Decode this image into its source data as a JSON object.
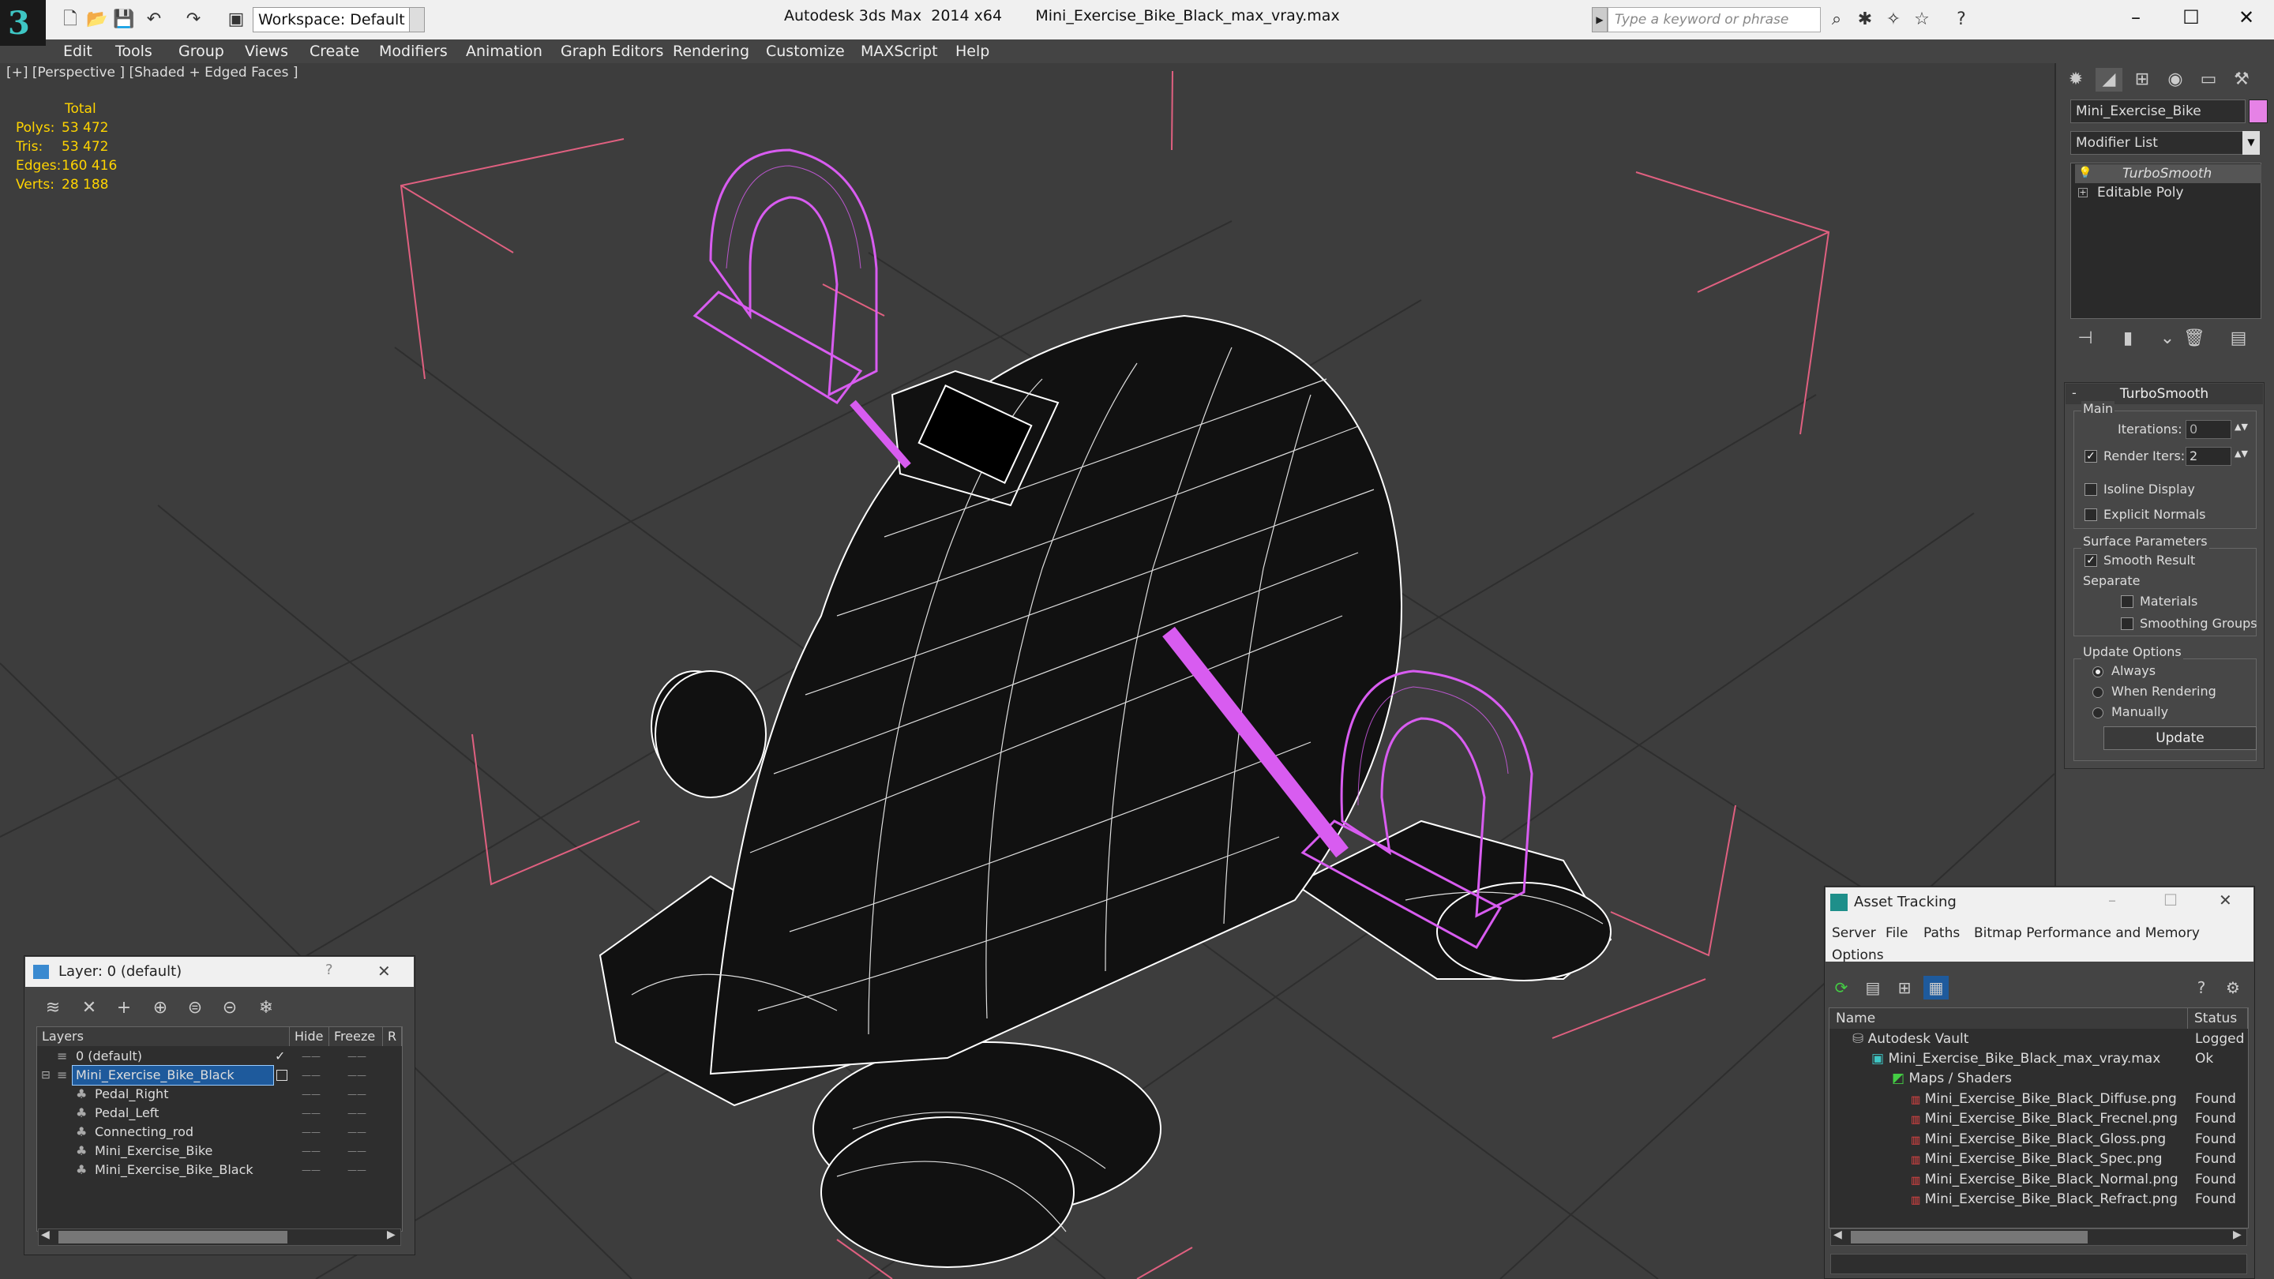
{
  "titlebar": {
    "app_title": "Autodesk 3ds Max  2014 x64       Mini_Exercise_Bike_Black_max_vray.max",
    "workspace": "Workspace: Default",
    "search_placeholder": "Type a keyword or phrase",
    "minimize": "–",
    "maximize": "☐",
    "close": "✕"
  },
  "menu": [
    "Edit",
    "Tools",
    "Group",
    "Views",
    "Create",
    "Modifiers",
    "Animation",
    "Graph Editors",
    "Rendering",
    "Customize",
    "MAXScript",
    "Help"
  ],
  "viewport": {
    "label": "[+] [Perspective ] [Shaded + Edged Faces ]",
    "stats": {
      "header": "Total",
      "polys_label": "Polys:",
      "polys": "53 472",
      "tris_label": "Tris:",
      "tris": "53 472",
      "edges_label": "Edges:",
      "edges": "160 416",
      "verts_label": "Verts:",
      "verts": "28 188"
    }
  },
  "command_panel": {
    "object_name": "Mini_Exercise_Bike",
    "object_color": "#e682e6",
    "modifier_list": "Modifier List",
    "stack": [
      "TurboSmooth",
      "Editable Poly"
    ],
    "turbosmooth": {
      "title": "TurboSmooth",
      "main_label": "Main",
      "iterations_label": "Iterations:",
      "iterations": "0",
      "render_iters_label": "Render Iters:",
      "render_iters": "2",
      "render_iters_checked": true,
      "isoline_display": "Isoline Display",
      "explicit_normals": "Explicit Normals",
      "surface_parameters": "Surface Parameters",
      "smooth_result": "Smooth Result",
      "separate": "Separate",
      "materials": "Materials",
      "smoothing_groups": "Smoothing Groups",
      "update_options": "Update Options",
      "always": "Always",
      "when_rendering": "When Rendering",
      "manually": "Manually",
      "update_button": "Update"
    }
  },
  "layer_dialog": {
    "title": "Layer: 0 (default)",
    "help": "?",
    "close": "✕",
    "columns": [
      "Layers",
      "Hide",
      "Freeze",
      "R"
    ],
    "rows": [
      {
        "name": "0 (default)",
        "indent": 0
      },
      {
        "name": "Mini_Exercise_Bike_Black",
        "indent": 0
      },
      {
        "name": "Pedal_Right",
        "indent": 1
      },
      {
        "name": "Pedal_Left",
        "indent": 1
      },
      {
        "name": "Connecting_rod",
        "indent": 1
      },
      {
        "name": "Mini_Exercise_Bike",
        "indent": 1
      },
      {
        "name": "Mini_Exercise_Bike_Black",
        "indent": 1
      }
    ]
  },
  "asset_tracking": {
    "title": "Asset Tracking",
    "menu": [
      "Server",
      "File",
      "Paths",
      "Bitmap Performance and Memory",
      "Options"
    ],
    "columns": [
      "Name",
      "Status"
    ],
    "rows": [
      {
        "name": "Autodesk Vault",
        "status": "Logged O",
        "indent": 0,
        "icon": "vault-icon"
      },
      {
        "name": "Mini_Exercise_Bike_Black_max_vray.max",
        "status": "Ok",
        "indent": 1,
        "icon": "max-file-icon"
      },
      {
        "name": "Maps / Shaders",
        "status": "",
        "indent": 2,
        "icon": "maps-folder-icon"
      },
      {
        "name": "Mini_Exercise_Bike_Black_Diffuse.png",
        "status": "Found",
        "indent": 3,
        "icon": "png-icon"
      },
      {
        "name": "Mini_Exercise_Bike_Black_Frecnel.png",
        "status": "Found",
        "indent": 3,
        "icon": "png-icon"
      },
      {
        "name": "Mini_Exercise_Bike_Black_Gloss.png",
        "status": "Found",
        "indent": 3,
        "icon": "png-icon"
      },
      {
        "name": "Mini_Exercise_Bike_Black_Spec.png",
        "status": "Found",
        "indent": 3,
        "icon": "png-icon"
      },
      {
        "name": "Mini_Exercise_Bike_Black_Normal.png",
        "status": "Found",
        "indent": 3,
        "icon": "png-icon"
      },
      {
        "name": "Mini_Exercise_Bike_Black_Refract.png",
        "status": "Found",
        "indent": 3,
        "icon": "png-icon"
      }
    ]
  },
  "colors": {
    "selection_wire": "#d85cf0",
    "stats": "#ffd400",
    "viewport_bg": "#3d3d3d"
  }
}
